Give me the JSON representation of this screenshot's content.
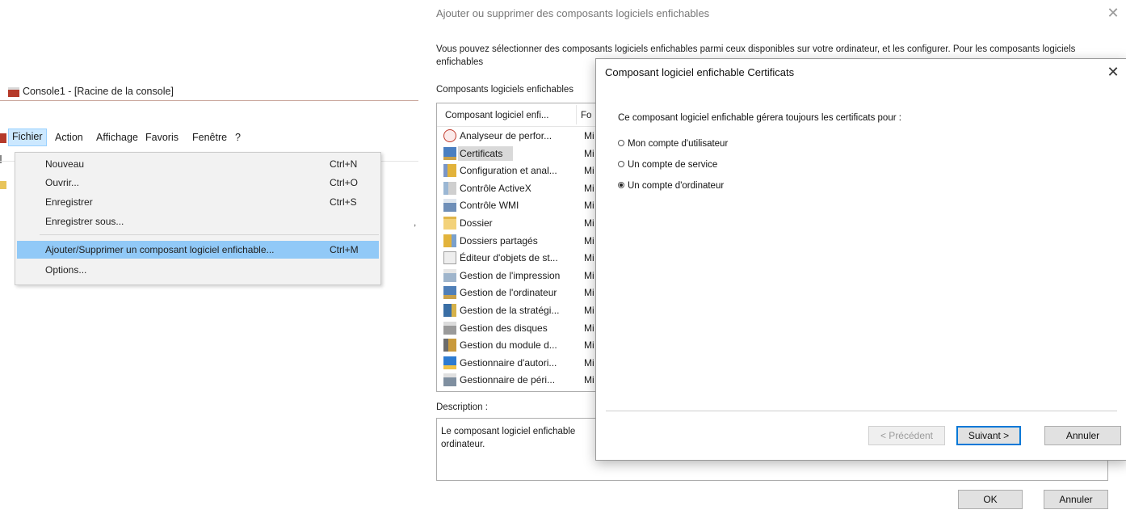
{
  "console": {
    "title": "Console1 - [Racine de la console]",
    "menubar": [
      {
        "label": "Fichier",
        "active": true
      },
      {
        "label": "Action"
      },
      {
        "label": "Affichage"
      },
      {
        "label": "Favoris"
      },
      {
        "label": "Fenêtre"
      },
      {
        "label": "?"
      }
    ],
    "file_menu": [
      {
        "label": "Nouveau",
        "shortcut": "Ctrl+N"
      },
      {
        "label": "Ouvrir...",
        "shortcut": "Ctrl+O"
      },
      {
        "label": "Enregistrer",
        "shortcut": "Ctrl+S"
      },
      {
        "label": "Enregistrer sous...",
        "shortcut": ""
      },
      {
        "label": "Ajouter/Supprimer un composant logiciel enfichable...",
        "shortcut": "Ctrl+M",
        "highlighted": true
      },
      {
        "label": "Options...",
        "shortcut": ""
      }
    ]
  },
  "add_remove": {
    "title": "Ajouter ou supprimer des composants logiciels enfichables",
    "intro": "Vous pouvez sélectionner des composants logiciels enfichables parmi ceux disponibles sur votre ordinateur, et les configurer. Pour les composants logiciels enfichables",
    "available_label": "Composants logiciels enfichables",
    "columns": [
      "Composant logiciel enfi...",
      "Fo"
    ],
    "snapins": [
      {
        "name": "Analyseur de perfor...",
        "publisher": "Mi",
        "icon": "performance-monitor-icon"
      },
      {
        "name": "Certificats",
        "publisher": "Mi",
        "icon": "certificate-icon",
        "selected": true
      },
      {
        "name": "Configuration et anal...",
        "publisher": "Mi",
        "icon": "security-configuration-icon"
      },
      {
        "name": "Contrôle ActiveX",
        "publisher": "Mi",
        "icon": "activex-icon"
      },
      {
        "name": "Contrôle WMI",
        "publisher": "Mi",
        "icon": "wmi-icon"
      },
      {
        "name": "Dossier",
        "publisher": "Mi",
        "icon": "folder-icon"
      },
      {
        "name": "Dossiers partagés",
        "publisher": "Mi",
        "icon": "shared-folders-icon"
      },
      {
        "name": "Éditeur d'objets de st...",
        "publisher": "Mi",
        "icon": "policy-editor-icon"
      },
      {
        "name": "Gestion de l'impression",
        "publisher": "Mi",
        "icon": "printer-icon"
      },
      {
        "name": "Gestion de l'ordinateur",
        "publisher": "Mi",
        "icon": "computer-management-icon"
      },
      {
        "name": "Gestion de la stratégi...",
        "publisher": "Mi",
        "icon": "group-policy-icon"
      },
      {
        "name": "Gestion des disques",
        "publisher": "Mi",
        "icon": "disk-management-icon"
      },
      {
        "name": "Gestion du module d...",
        "publisher": "Mi",
        "icon": "tpm-icon"
      },
      {
        "name": "Gestionnaire d'autori...",
        "publisher": "Mi",
        "icon": "authorization-manager-icon"
      },
      {
        "name": "Gestionnaire de péri...",
        "publisher": "Mi",
        "icon": "device-manager-icon"
      }
    ],
    "description_label": "Description :",
    "description_text": "Le composant logiciel enfichable ordinateur.",
    "ok_label": "OK",
    "cancel_label": "Annuler"
  },
  "cert_dialog": {
    "title": "Composant logiciel enfichable Certificats",
    "prompt": "Ce composant logiciel enfichable gérera toujours les certificats pour :",
    "options": [
      {
        "label": "Mon compte d'utilisateur",
        "checked": false
      },
      {
        "label": "Un compte de service",
        "checked": false
      },
      {
        "label": "Un compte d'ordinateur",
        "checked": true
      }
    ],
    "back_label": "< Précédent",
    "next_label": "Suivant >",
    "cancel_label": "Annuler"
  },
  "colors": {
    "menu_highlight": "#91c9f7",
    "primary_border": "#0078d7",
    "list_selection": "#d9d9d9"
  }
}
